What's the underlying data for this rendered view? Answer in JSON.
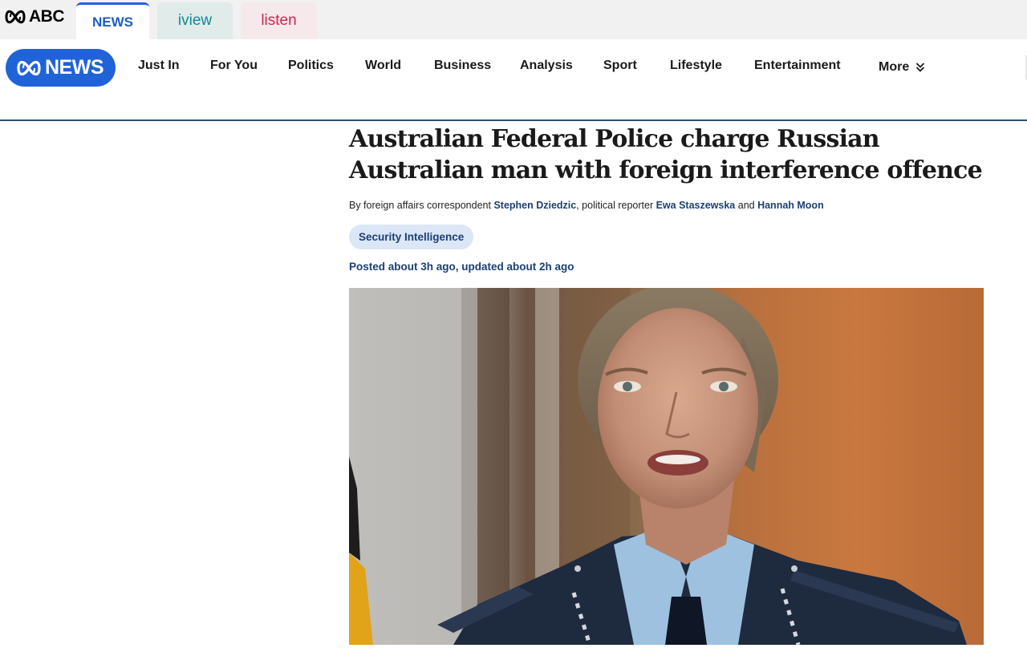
{
  "network": {
    "brand_label": "ABC",
    "brand_icon": "abc-lissajous-icon",
    "tabs": [
      {
        "label": "NEWS",
        "active": true,
        "color": "#1e5bc6"
      },
      {
        "label": "iview",
        "active": false,
        "color": "#0b8a9a"
      },
      {
        "label": "listen",
        "active": false,
        "color": "#d4234d"
      }
    ]
  },
  "nav": {
    "logo_label": "NEWS",
    "logo_color": "#2063d9",
    "items": [
      "Just In",
      "For You",
      "Politics",
      "World",
      "Business",
      "Analysis",
      "Sport",
      "Lifestyle",
      "Entertainment"
    ],
    "more_label": "More",
    "more_icon": "double-chevron-down-icon"
  },
  "article": {
    "headline": "Australian Federal Police charge Russian Australian man with foreign interference offence",
    "byline": {
      "prefix": "By foreign affairs correspondent ",
      "author1": "Stephen Dziedzic",
      "mid": ", political reporter ",
      "author2": "Ewa Staszewska",
      "conj": " and ",
      "author3": "Hannah Moon"
    },
    "topic": "Security Intelligence",
    "posted": "Posted about 3h ago, updated about 2h ago",
    "hero_image": "photo of a uniformed police officer speaking"
  },
  "colors": {
    "accent": "#2063d9",
    "link": "#1b3f73",
    "tag_bg": "#dbe6f6"
  }
}
